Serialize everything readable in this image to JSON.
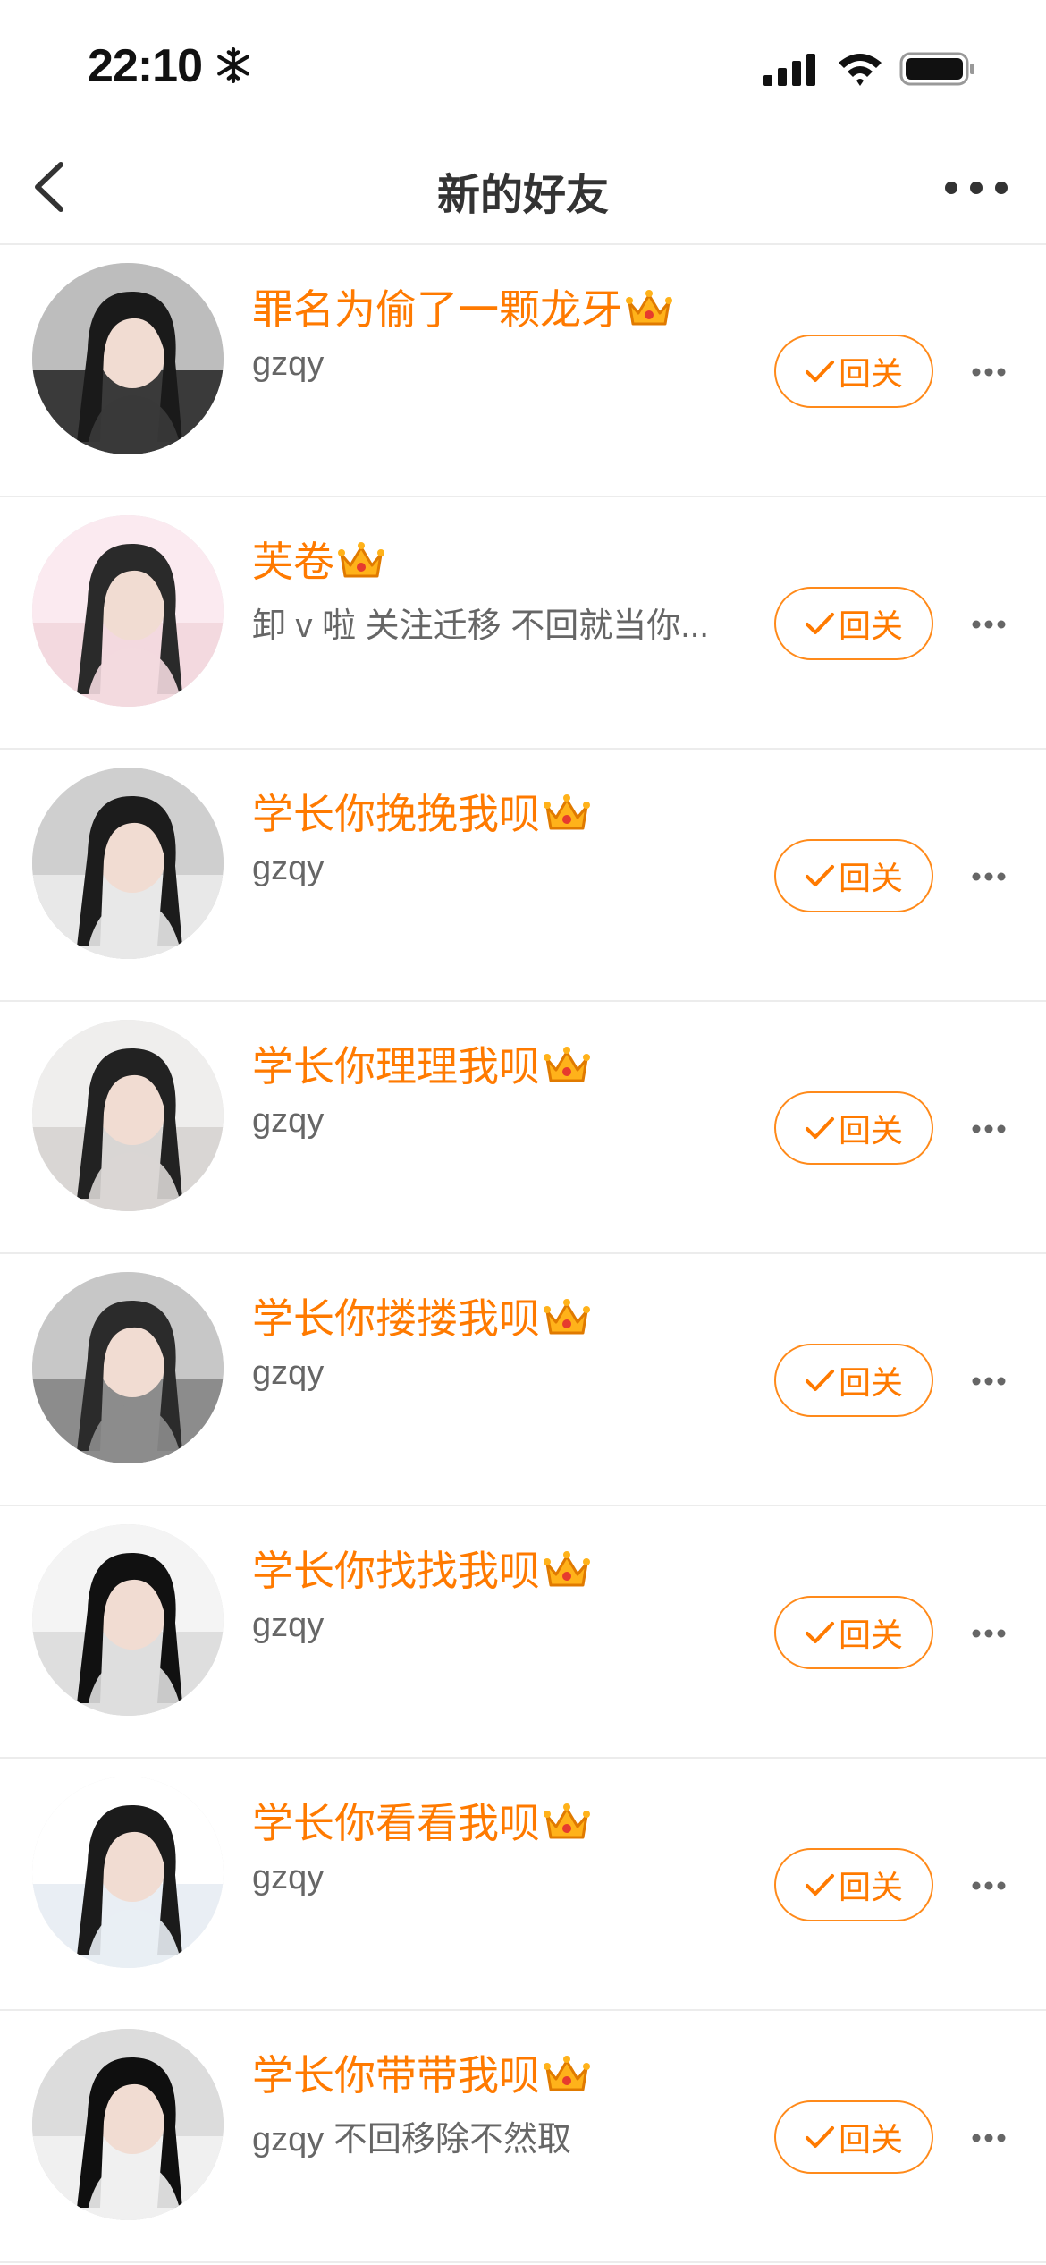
{
  "status": {
    "time": "22:10"
  },
  "nav": {
    "title": "新的好友"
  },
  "rows": [
    {
      "name": "罪名为偷了一颗龙牙",
      "desc": "gzqy",
      "button": "回关"
    },
    {
      "name": "芙卷",
      "desc": "卸 v 啦 关注迁移 不回就当你...",
      "button": "回关"
    },
    {
      "name": "学长你挽挽我呗",
      "desc": "gzqy",
      "button": "回关"
    },
    {
      "name": "学长你理理我呗",
      "desc": "gzqy",
      "button": "回关"
    },
    {
      "name": "学长你搂搂我呗",
      "desc": "gzqy",
      "button": "回关"
    },
    {
      "name": "学长你找找我呗",
      "desc": "gzqy",
      "button": "回关"
    },
    {
      "name": "学长你看看我呗",
      "desc": "gzqy",
      "button": "回关"
    },
    {
      "name": "学长你带带我呗",
      "desc": "gzqy 不回移除不然取",
      "button": "回关"
    }
  ],
  "colors": {
    "accent": "#ff7a00",
    "text": "#333333",
    "subtext": "#666666",
    "divider": "#ececec"
  }
}
